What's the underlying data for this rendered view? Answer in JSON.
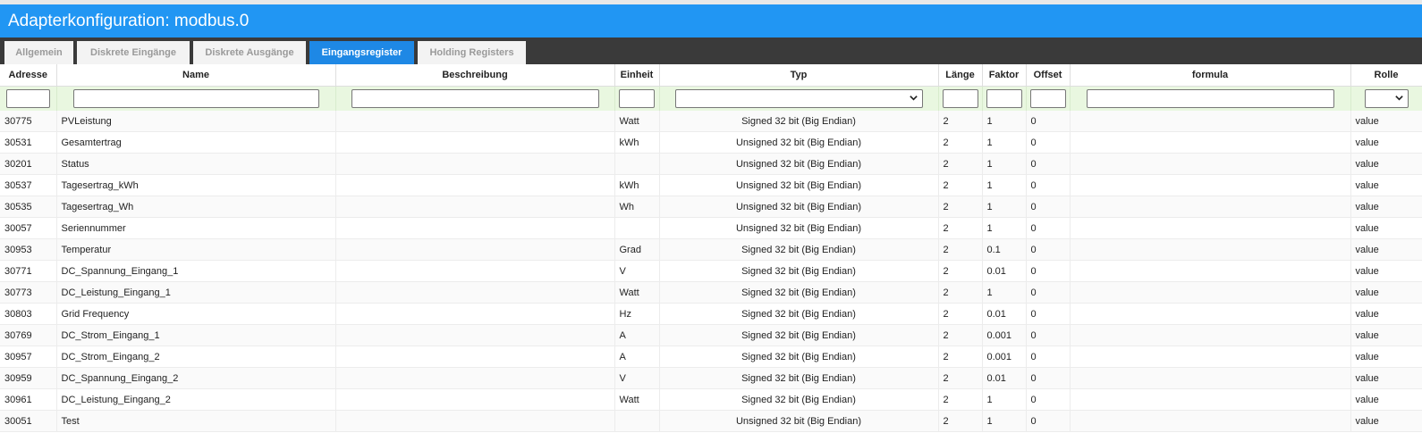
{
  "window": {
    "title": "Adapterkonfiguration: modbus.0"
  },
  "tabs": [
    {
      "label": "Allgemein",
      "active": false
    },
    {
      "label": "Diskrete Eingänge",
      "active": false
    },
    {
      "label": "Diskrete Ausgänge",
      "active": false
    },
    {
      "label": "Eingangsregister",
      "active": true
    },
    {
      "label": "Holding Registers",
      "active": false
    }
  ],
  "columns": [
    "Adresse",
    "Name",
    "Beschreibung",
    "Einheit",
    "Typ",
    "Länge",
    "Faktor",
    "Offset",
    "formula",
    "Rolle"
  ],
  "rows": [
    {
      "adresse": "30775",
      "name": "PVLeistung",
      "beschreibung": "",
      "einheit": "Watt",
      "typ": "Signed 32 bit (Big Endian)",
      "laenge": "2",
      "faktor": "1",
      "offset": "0",
      "formula": "",
      "rolle": "value"
    },
    {
      "adresse": "30531",
      "name": "Gesamtertrag",
      "beschreibung": "",
      "einheit": "kWh",
      "typ": "Unsigned 32 bit (Big Endian)",
      "laenge": "2",
      "faktor": "1",
      "offset": "0",
      "formula": "",
      "rolle": "value"
    },
    {
      "adresse": "30201",
      "name": "Status",
      "beschreibung": "",
      "einheit": "",
      "typ": "Unsigned 32 bit (Big Endian)",
      "laenge": "2",
      "faktor": "1",
      "offset": "0",
      "formula": "",
      "rolle": "value"
    },
    {
      "adresse": "30537",
      "name": "Tagesertrag_kWh",
      "beschreibung": "",
      "einheit": "kWh",
      "typ": "Unsigned 32 bit (Big Endian)",
      "laenge": "2",
      "faktor": "1",
      "offset": "0",
      "formula": "",
      "rolle": "value"
    },
    {
      "adresse": "30535",
      "name": "Tagesertrag_Wh",
      "beschreibung": "",
      "einheit": "Wh",
      "typ": "Unsigned 32 bit (Big Endian)",
      "laenge": "2",
      "faktor": "1",
      "offset": "0",
      "formula": "",
      "rolle": "value"
    },
    {
      "adresse": "30057",
      "name": "Seriennummer",
      "beschreibung": "",
      "einheit": "",
      "typ": "Unsigned 32 bit (Big Endian)",
      "laenge": "2",
      "faktor": "1",
      "offset": "0",
      "formula": "",
      "rolle": "value"
    },
    {
      "adresse": "30953",
      "name": "Temperatur",
      "beschreibung": "",
      "einheit": "Grad",
      "typ": "Signed 32 bit (Big Endian)",
      "laenge": "2",
      "faktor": "0.1",
      "offset": "0",
      "formula": "",
      "rolle": "value"
    },
    {
      "adresse": "30771",
      "name": "DC_Spannung_Eingang_1",
      "beschreibung": "",
      "einheit": "V",
      "typ": "Signed 32 bit (Big Endian)",
      "laenge": "2",
      "faktor": "0.01",
      "offset": "0",
      "formula": "",
      "rolle": "value"
    },
    {
      "adresse": "30773",
      "name": "DC_Leistung_Eingang_1",
      "beschreibung": "",
      "einheit": "Watt",
      "typ": "Signed 32 bit (Big Endian)",
      "laenge": "2",
      "faktor": "1",
      "offset": "0",
      "formula": "",
      "rolle": "value"
    },
    {
      "adresse": "30803",
      "name": "Grid Frequency",
      "beschreibung": "",
      "einheit": "Hz",
      "typ": "Signed 32 bit (Big Endian)",
      "laenge": "2",
      "faktor": "0.01",
      "offset": "0",
      "formula": "",
      "rolle": "value"
    },
    {
      "adresse": "30769",
      "name": "DC_Strom_Eingang_1",
      "beschreibung": "",
      "einheit": "A",
      "typ": "Signed 32 bit (Big Endian)",
      "laenge": "2",
      "faktor": "0.001",
      "offset": "0",
      "formula": "",
      "rolle": "value"
    },
    {
      "adresse": "30957",
      "name": "DC_Strom_Eingang_2",
      "beschreibung": "",
      "einheit": "A",
      "typ": "Signed 32 bit (Big Endian)",
      "laenge": "2",
      "faktor": "0.001",
      "offset": "0",
      "formula": "",
      "rolle": "value"
    },
    {
      "adresse": "30959",
      "name": "DC_Spannung_Eingang_2",
      "beschreibung": "",
      "einheit": "V",
      "typ": "Signed 32 bit (Big Endian)",
      "laenge": "2",
      "faktor": "0.01",
      "offset": "0",
      "formula": "",
      "rolle": "value"
    },
    {
      "adresse": "30961",
      "name": "DC_Leistung_Eingang_2",
      "beschreibung": "",
      "einheit": "Watt",
      "typ": "Signed 32 bit (Big Endian)",
      "laenge": "2",
      "faktor": "1",
      "offset": "0",
      "formula": "",
      "rolle": "value"
    },
    {
      "adresse": "30051",
      "name": "Test",
      "beschreibung": "",
      "einheit": "",
      "typ": "Unsigned 32 bit (Big Endian)",
      "laenge": "2",
      "faktor": "1",
      "offset": "0",
      "formula": "",
      "rolle": "value"
    }
  ],
  "colors": {
    "titlebar": "#2196f3",
    "tabbar": "#3a3a3a",
    "active_tab": "#1e88e5",
    "filter_row": "#e9f7e0"
  },
  "icons": {
    "select_arrow": "chevron-down-icon"
  }
}
